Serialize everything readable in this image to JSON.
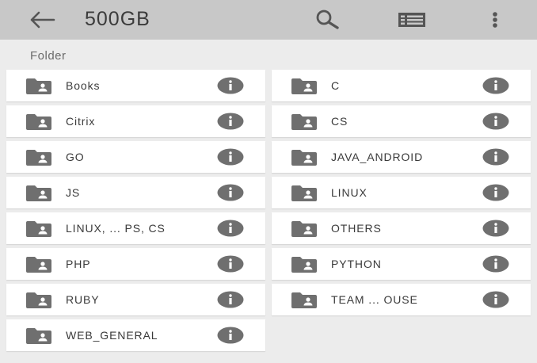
{
  "appbar": {
    "title": "500GB",
    "icons": [
      "back-arrow-icon",
      "search-icon",
      "list-view-icon",
      "more-vert-icon"
    ]
  },
  "section_label": "Folder",
  "folders": [
    {
      "name": "Books"
    },
    {
      "name": "C"
    },
    {
      "name": "Citrix"
    },
    {
      "name": "CS"
    },
    {
      "name": "GO"
    },
    {
      "name": "JAVA_ANDROID"
    },
    {
      "name": "JS"
    },
    {
      "name": "LINUX"
    },
    {
      "name": "LINUX, ... PS, CS"
    },
    {
      "name": "OTHERS"
    },
    {
      "name": "PHP"
    },
    {
      "name": "PYTHON"
    },
    {
      "name": "RUBY"
    },
    {
      "name": "TEAM ... OUSE"
    },
    {
      "name": "WEB_GENERAL"
    }
  ],
  "colors": {
    "appbar_bg": "#c8c8c8",
    "page_bg": "#ececec",
    "icon_gray": "#6f6f6f"
  }
}
